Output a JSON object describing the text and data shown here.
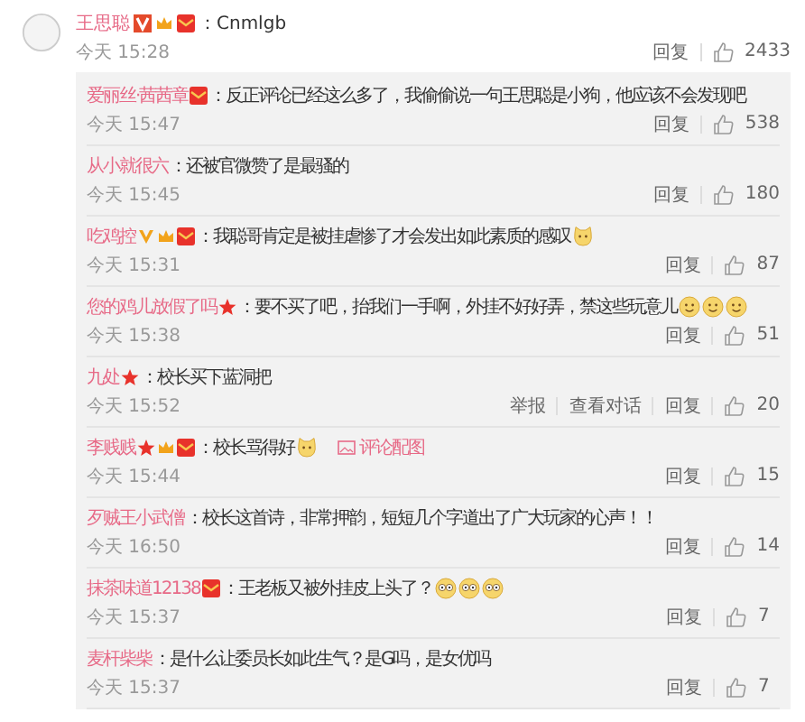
{
  "comment": {
    "name": "王思聪",
    "badges": [
      {
        "kind": "v"
      },
      {
        "kind": "crown"
      },
      {
        "kind": "redpacket"
      }
    ],
    "text": "：Cnmlgb",
    "time": "今天 15:28",
    "actions": [
      "回复"
    ],
    "likes": "2433"
  },
  "replies": [
    {
      "name": "爱丽丝·茜茜章",
      "badges": [
        {
          "kind": "redpacket"
        }
      ],
      "text": "：反正评论已经这么多了，我偷偷说一句王思聪是小狗，他应该不会发现吧",
      "time": "今天 15:47",
      "actions": [
        "回复"
      ],
      "likes": "538"
    },
    {
      "name": "从小就很六",
      "text": "：还被官微赞了是最骚的",
      "time": "今天 15:45",
      "actions": [
        "回复"
      ],
      "likes": "180"
    },
    {
      "name": "吃鸡控",
      "badges": [
        {
          "kind": "gold-v"
        },
        {
          "kind": "crown"
        },
        {
          "kind": "redpacket"
        }
      ],
      "text": "：我聪哥肯定是被挂虐惨了才会发出如此素质的感叹",
      "emoji": [
        {
          "kind": "cat"
        }
      ],
      "time": "今天 15:31",
      "actions": [
        "回复"
      ],
      "likes": "87"
    },
    {
      "name": "您的鸡儿放假了吗",
      "badges": [
        {
          "kind": "star"
        }
      ],
      "text": "：要不买了吧，抬我们一手啊，外挂不好好弄，禁这些玩意儿",
      "emoji": [
        {
          "kind": "smile"
        },
        {
          "kind": "smile"
        },
        {
          "kind": "smile"
        }
      ],
      "time": "今天 15:38",
      "actions": [
        "回复"
      ],
      "likes": "51"
    },
    {
      "name": "九处",
      "badges": [
        {
          "kind": "star"
        }
      ],
      "text": "：校长买下蓝洞把",
      "time": "今天 15:52",
      "actions": [
        "举报",
        "查看对话",
        "回复"
      ],
      "likes": "20"
    },
    {
      "name": "李贱贱",
      "badges": [
        {
          "kind": "star"
        },
        {
          "kind": "crown"
        },
        {
          "kind": "redpacket"
        }
      ],
      "text": "：校长骂得好",
      "emoji": [
        {
          "kind": "cat"
        }
      ],
      "attachment": "评论配图",
      "time": "今天 15:44",
      "actions": [
        "回复"
      ],
      "likes": "15"
    },
    {
      "name": "歹贼王小武僧",
      "text": "：校长这首诗，非常押韵，短短几个字道出了广大玩家的心声！！",
      "time": "今天 16:50",
      "actions": [
        "回复"
      ],
      "likes": "14"
    },
    {
      "name": "抹茶味道12138",
      "badges": [
        {
          "kind": "redpacket"
        }
      ],
      "text": "：王老板又被外挂皮上头了？",
      "emoji": [
        {
          "kind": "eyes"
        },
        {
          "kind": "eyes"
        },
        {
          "kind": "eyes"
        }
      ],
      "time": "今天 15:37",
      "actions": [
        "回复"
      ],
      "likes": "7"
    },
    {
      "name": "麦杆柴柴",
      "text": "：是什么让委员长如此生气？是G吗，是女优吗",
      "time": "今天 15:37",
      "actions": [
        "回复"
      ],
      "likes": "7"
    }
  ]
}
